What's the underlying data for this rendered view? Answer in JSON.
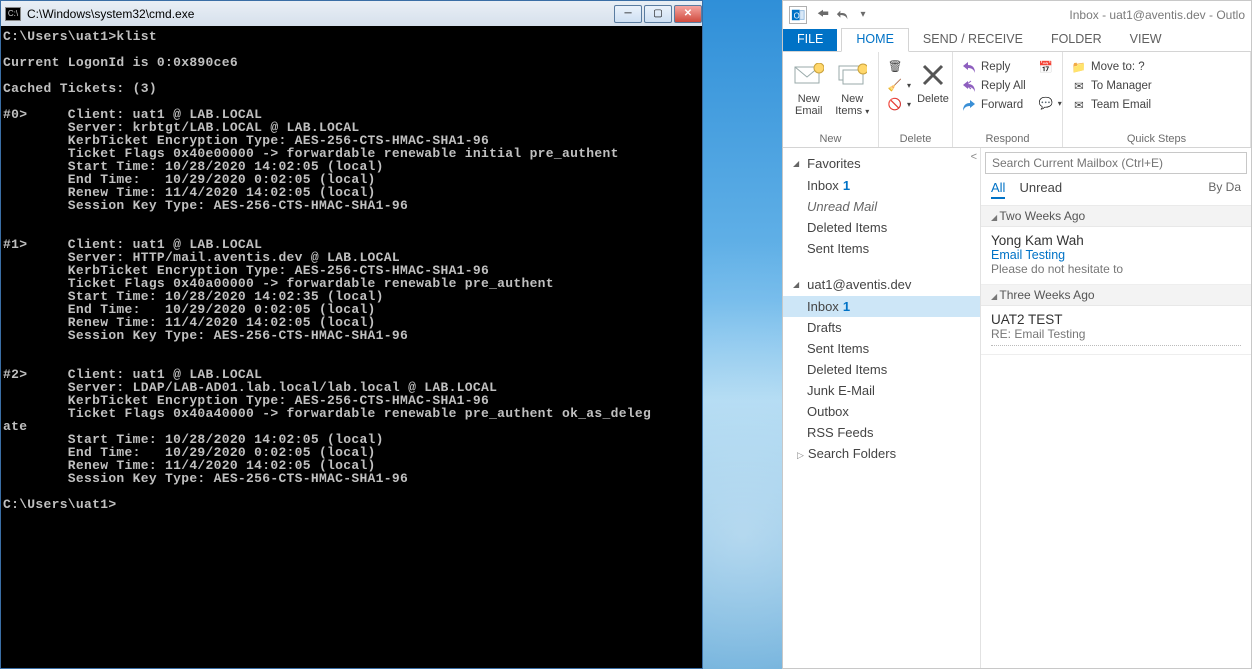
{
  "cmd": {
    "title": "C:\\Windows\\system32\\cmd.exe",
    "text": "C:\\Users\\uat1>klist\n\nCurrent LogonId is 0:0x890ce6\n\nCached Tickets: (3)\n\n#0>     Client: uat1 @ LAB.LOCAL\n        Server: krbtgt/LAB.LOCAL @ LAB.LOCAL\n        KerbTicket Encryption Type: AES-256-CTS-HMAC-SHA1-96\n        Ticket Flags 0x40e00000 -> forwardable renewable initial pre_authent\n        Start Time: 10/28/2020 14:02:05 (local)\n        End Time:   10/29/2020 0:02:05 (local)\n        Renew Time: 11/4/2020 14:02:05 (local)\n        Session Key Type: AES-256-CTS-HMAC-SHA1-96\n\n\n#1>     Client: uat1 @ LAB.LOCAL\n        Server: HTTP/mail.aventis.dev @ LAB.LOCAL\n        KerbTicket Encryption Type: AES-256-CTS-HMAC-SHA1-96\n        Ticket Flags 0x40a00000 -> forwardable renewable pre_authent\n        Start Time: 10/28/2020 14:02:35 (local)\n        End Time:   10/29/2020 0:02:05 (local)\n        Renew Time: 11/4/2020 14:02:05 (local)\n        Session Key Type: AES-256-CTS-HMAC-SHA1-96\n\n\n#2>     Client: uat1 @ LAB.LOCAL\n        Server: LDAP/LAB-AD01.lab.local/lab.local @ LAB.LOCAL\n        KerbTicket Encryption Type: AES-256-CTS-HMAC-SHA1-96\n        Ticket Flags 0x40a40000 -> forwardable renewable pre_authent ok_as_deleg\nate\n        Start Time: 10/28/2020 14:02:05 (local)\n        End Time:   10/29/2020 0:02:05 (local)\n        Renew Time: 11/4/2020 14:02:05 (local)\n        Session Key Type: AES-256-CTS-HMAC-SHA1-96\n\nC:\\Users\\uat1>"
  },
  "outlook": {
    "title": "Inbox - uat1@aventis.dev - Outlo",
    "tabs": {
      "file": "FILE",
      "home": "HOME",
      "sendrecv": "SEND / RECEIVE",
      "folder": "FOLDER",
      "view": "VIEW"
    },
    "ribbon": {
      "new_group": "New",
      "new_email": "New Email",
      "new_items": "New Items",
      "delete_group": "Delete",
      "delete": "Delete",
      "respond_group": "Respond",
      "reply": "Reply",
      "reply_all": "Reply All",
      "forward": "Forward",
      "qs_group": "Quick Steps",
      "move_to": "Move to: ?",
      "to_manager": "To Manager",
      "team_email": "Team Email"
    },
    "nav": {
      "favorites": "Favorites",
      "inbox": "Inbox",
      "inbox_count": "1",
      "unread_mail": "Unread Mail",
      "deleted": "Deleted Items",
      "sent": "Sent Items",
      "account": "uat1@aventis.dev",
      "drafts": "Drafts",
      "junk": "Junk E-Mail",
      "outbox": "Outbox",
      "rss": "RSS Feeds",
      "search_folders": "Search Folders"
    },
    "list": {
      "search_placeholder": "Search Current Mailbox (Ctrl+E)",
      "all": "All",
      "unread": "Unread",
      "byda": "By Da",
      "g1": "Two Weeks Ago",
      "m1_from": "Yong Kam Wah",
      "m1_subj": "Email Testing",
      "m1_prev": "Please do not hesitate to",
      "g2": "Three Weeks Ago",
      "m2_from": "UAT2 TEST",
      "m2_subj": "RE: Email Testing"
    }
  }
}
